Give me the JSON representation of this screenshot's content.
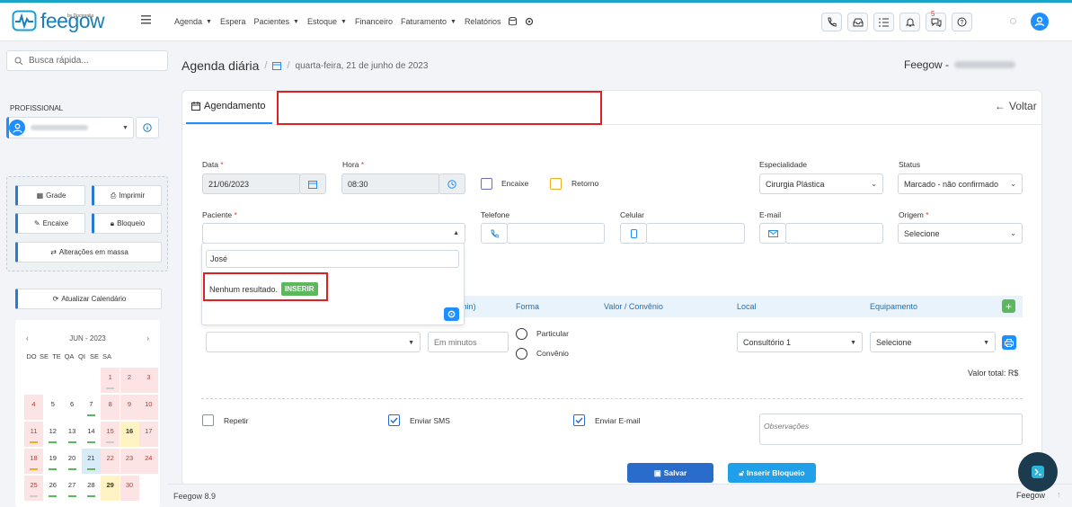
{
  "brand": {
    "logo_text": "feegow",
    "by": "by Doctoralia"
  },
  "nav": [
    {
      "label": "Agenda",
      "caret": true
    },
    {
      "label": "Espera",
      "caret": false
    },
    {
      "label": "Pacientes",
      "caret": true
    },
    {
      "label": "Estoque",
      "caret": true
    },
    {
      "label": "Financeiro",
      "caret": false
    },
    {
      "label": "Faturamento",
      "caret": true
    },
    {
      "label": "Relatórios",
      "caret": false
    }
  ],
  "notifications": {
    "count": "5"
  },
  "sidebar": {
    "search_placeholder": "Busca rápida...",
    "profissional_label": "PROFISSIONAL",
    "actions": {
      "grade": "Grade",
      "imprimir": "Imprimir",
      "encaixe": "Encaixe",
      "bloqueio": "Bloqueio",
      "massa": "Alterações em massa"
    },
    "update": "Atualizar Calendário",
    "calendar": {
      "month": "JUN - 2023",
      "dow": [
        "DO",
        "SE",
        "TE",
        "QA",
        "QI",
        "SE",
        "SA"
      ],
      "weeks": [
        [
          "",
          "",
          "",
          "",
          "1",
          "2",
          "3"
        ],
        [
          "4",
          "5",
          "6",
          "7",
          "8",
          "9",
          "10"
        ],
        [
          "11",
          "12",
          "13",
          "14",
          "15",
          "16",
          "17"
        ],
        [
          "18",
          "19",
          "20",
          "21",
          "22",
          "23",
          "24"
        ],
        [
          "25",
          "26",
          "27",
          "28",
          "29",
          "30",
          ""
        ]
      ]
    }
  },
  "breadcrumb": {
    "title": "Agenda diária",
    "date": "quarta-feira, 21 de junho de 2023"
  },
  "header_right": "Feegow -",
  "tab": "Agendamento",
  "voltar": "Voltar",
  "form": {
    "data_label": "Data",
    "data_value": "21/06/2023",
    "hora_label": "Hora",
    "hora_value": "08:30",
    "encaixe": "Encaixe",
    "retorno": "Retorno",
    "especialidade_label": "Especialidade",
    "especialidade_value": "Cirurgia Plástica",
    "status_label": "Status",
    "status_value": "Marcado - não confirmado",
    "paciente_label": "Paciente",
    "telefone_label": "Telefone",
    "celular_label": "Celular",
    "email_label": "E-mail",
    "origem_label": "Origem",
    "origem_value": "Selecione",
    "dropdown_search": "José",
    "no_result": "Nenhum resultado.",
    "inserir": "INSERIR",
    "col_tempo_fragment": "min)",
    "col_forma": "Forma",
    "col_valor": "Valor / Convênio",
    "col_local": "Local",
    "col_equip": "Equipamento",
    "minutos_placeholder": "Em minutos",
    "particular": "Particular",
    "convenio": "Convênio",
    "local_value": "Consultório 1",
    "equip_value": "Selecione",
    "valor_total": "Valor total: R$",
    "repetir": "Repetir",
    "enviar_sms": "Enviar SMS",
    "enviar_email": "Enviar E-mail",
    "obs_placeholder": "Observações",
    "salvar": "Salvar",
    "inserir_bloqueio": "Inserir Bloqueio"
  },
  "footer": {
    "version": "Feegow 8.9",
    "brand": "Feegow"
  },
  "colors": {
    "primary": "#1f8fff",
    "success": "#5cb85c",
    "danger": "#e02020",
    "brand": "#1a7fb8"
  }
}
